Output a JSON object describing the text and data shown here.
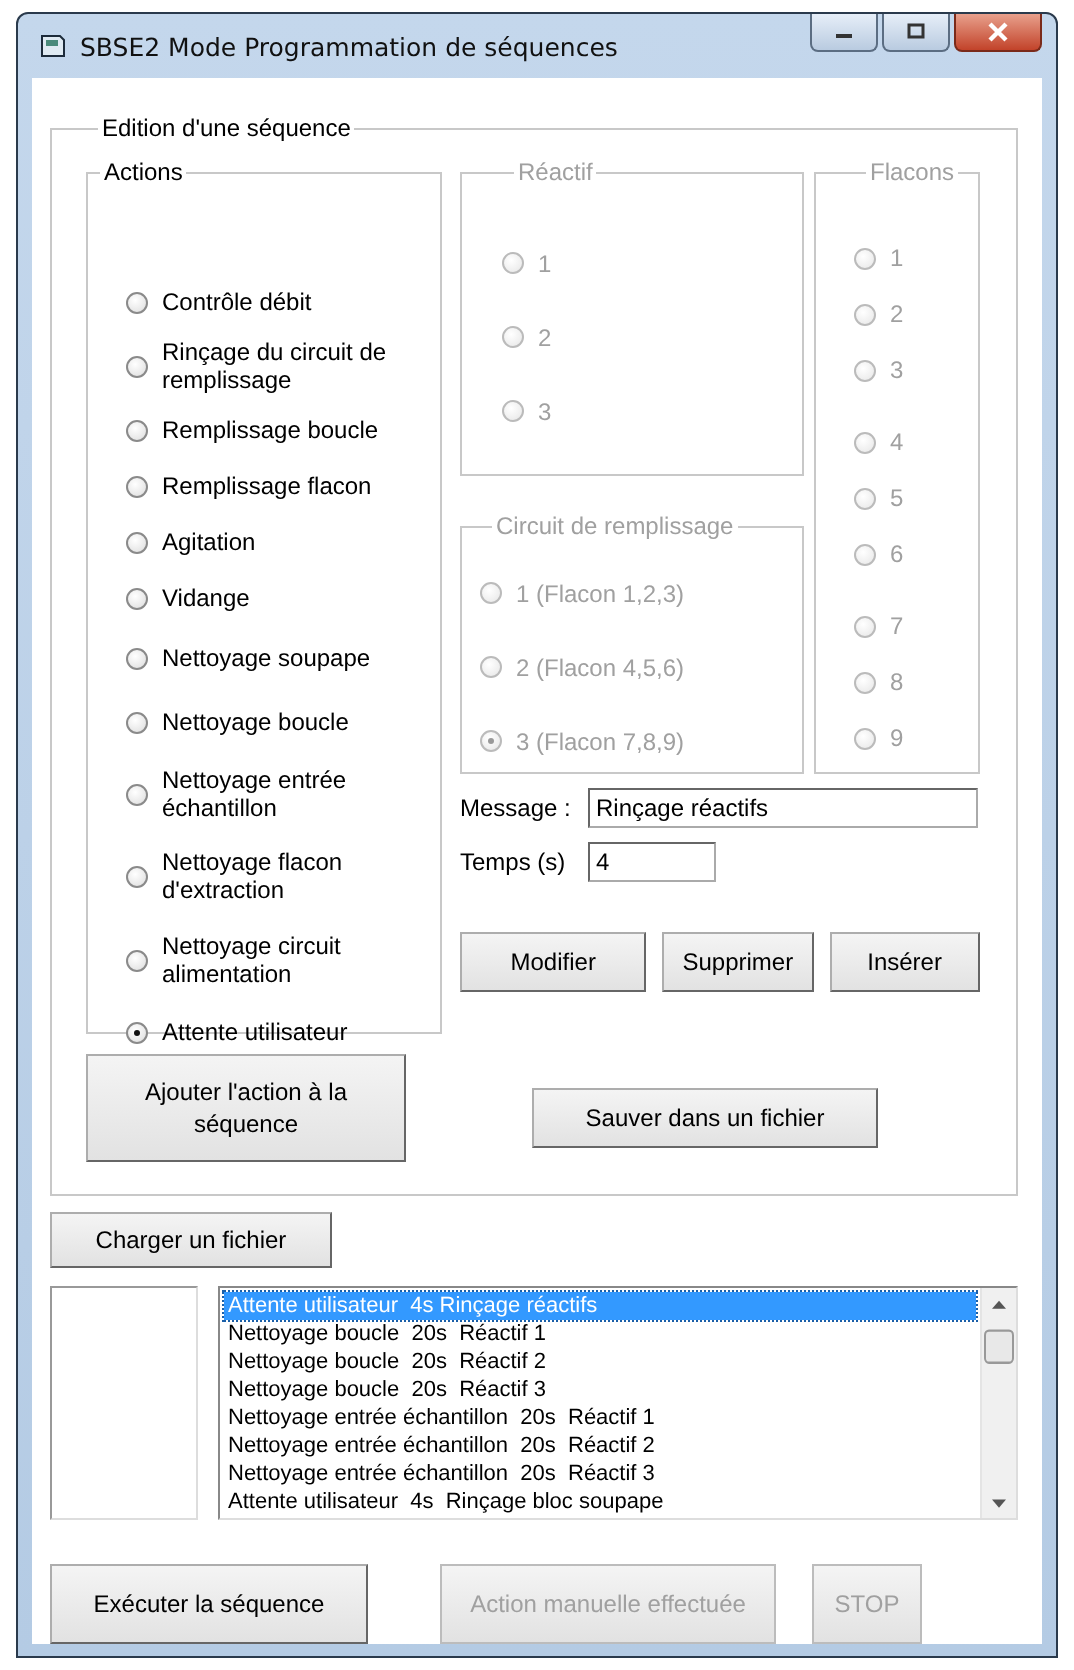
{
  "window": {
    "title": "SBSE2 Mode Programmation de séquences"
  },
  "edition": {
    "title": "Edition d'une séquence",
    "actions": {
      "title": "Actions",
      "disabled": false,
      "items": [
        {
          "label": "Contrôle débit",
          "selected": false
        },
        {
          "label": "Rinçage du circuit de\nremplissage",
          "selected": false
        },
        {
          "label": "Remplissage boucle",
          "selected": false
        },
        {
          "label": "Remplissage flacon",
          "selected": false
        },
        {
          "label": "Agitation",
          "selected": false
        },
        {
          "label": "Vidange",
          "selected": false
        },
        {
          "label": "Nettoyage soupape",
          "selected": false
        },
        {
          "label": "Nettoyage boucle",
          "selected": false
        },
        {
          "label": "Nettoyage entrée\néchantillon",
          "selected": false
        },
        {
          "label": "Nettoyage flacon\nd'extraction",
          "selected": false
        },
        {
          "label": "Nettoyage circuit\nalimentation",
          "selected": false
        },
        {
          "label": "Attente utilisateur",
          "selected": true
        }
      ]
    },
    "reactif": {
      "title": "Réactif",
      "disabled": true,
      "items": [
        {
          "label": "1",
          "selected": false
        },
        {
          "label": "2",
          "selected": false
        },
        {
          "label": "3",
          "selected": false
        }
      ]
    },
    "circuit": {
      "title": "Circuit de remplissage",
      "disabled": true,
      "items": [
        {
          "label": "1 (Flacon 1,2,3)",
          "selected": false
        },
        {
          "label": "2 (Flacon 4,5,6)",
          "selected": false
        },
        {
          "label": "3 (Flacon 7,8,9)",
          "selected": true
        }
      ]
    },
    "flacons": {
      "title": "Flacons",
      "disabled": true,
      "items": [
        {
          "label": "1",
          "selected": false
        },
        {
          "label": "2",
          "selected": false
        },
        {
          "label": "3",
          "selected": false
        },
        {
          "label": "4",
          "selected": false
        },
        {
          "label": "5",
          "selected": false
        },
        {
          "label": "6",
          "selected": false
        },
        {
          "label": "7",
          "selected": false
        },
        {
          "label": "8",
          "selected": false
        },
        {
          "label": "9",
          "selected": false
        }
      ]
    },
    "message": {
      "label": "Message :",
      "value": "Rinçage réactifs"
    },
    "temps": {
      "label": "Temps (s)",
      "value": "4"
    },
    "edit_buttons": [
      {
        "label": "Modifier",
        "disabled": false
      },
      {
        "label": "Supprimer",
        "disabled": false
      },
      {
        "label": "Insérer",
        "disabled": false
      }
    ],
    "add_button": {
      "label": "Ajouter l'action à la\nséquence",
      "disabled": false
    },
    "save_button": {
      "label": "Sauver dans un fichier",
      "disabled": false
    }
  },
  "load_button": {
    "label": "Charger un fichier",
    "disabled": false
  },
  "sequence_list": {
    "items": [
      {
        "text": "Attente utilisateur  4s Rinçage réactifs",
        "selected": true
      },
      {
        "text": "Nettoyage boucle  20s  Réactif 1",
        "selected": false
      },
      {
        "text": "Nettoyage boucle  20s  Réactif 2",
        "selected": false
      },
      {
        "text": "Nettoyage boucle  20s  Réactif 3",
        "selected": false
      },
      {
        "text": "Nettoyage entrée échantillon  20s  Réactif 1",
        "selected": false
      },
      {
        "text": "Nettoyage entrée échantillon  20s  Réactif 2",
        "selected": false
      },
      {
        "text": "Nettoyage entrée échantillon  20s  Réactif 3",
        "selected": false
      },
      {
        "text": "Attente utilisateur  4s  Rinçage bloc soupape",
        "selected": false
      }
    ]
  },
  "bottom_buttons": [
    {
      "label": "Exécuter la séquence",
      "disabled": false
    },
    {
      "label": "Action manuelle effectuée",
      "disabled": true
    },
    {
      "label": "STOP",
      "disabled": true
    }
  ]
}
